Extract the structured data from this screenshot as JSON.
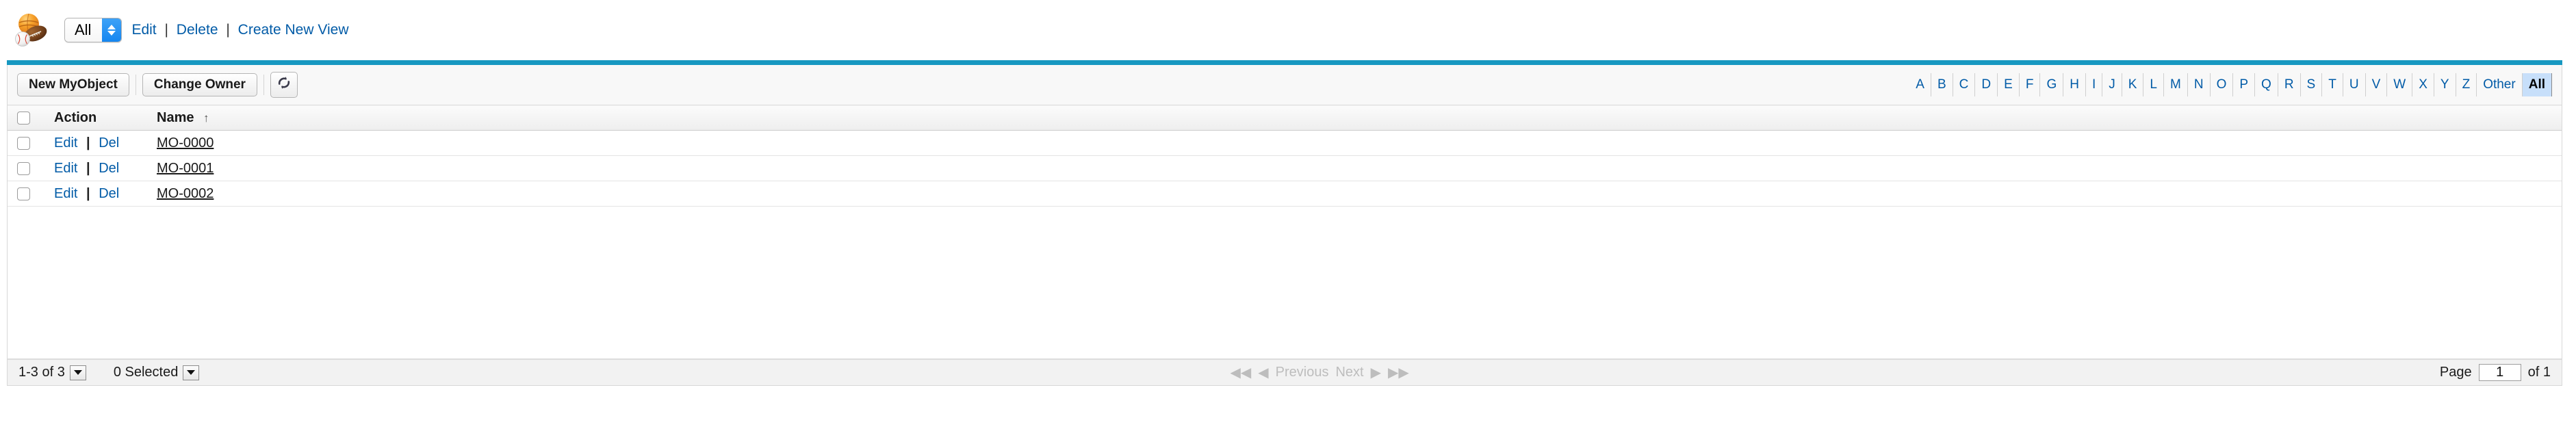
{
  "header": {
    "object_icon": "sports-balls-icon",
    "view_select": {
      "value": "All",
      "stepper_icon": "stepper-updown-icon"
    },
    "links": [
      {
        "label": "Edit",
        "name": "edit-view-link"
      },
      {
        "label": "Delete",
        "name": "delete-view-link"
      },
      {
        "label": "Create New View",
        "name": "create-new-view-link"
      }
    ],
    "separator": "|"
  },
  "toolbar": {
    "new_button": "New MyObject",
    "change_owner_button": "Change Owner",
    "refresh_icon": "refresh-icon"
  },
  "alpha_filter": {
    "letters": [
      "A",
      "B",
      "C",
      "D",
      "E",
      "F",
      "G",
      "H",
      "I",
      "J",
      "K",
      "L",
      "M",
      "N",
      "O",
      "P",
      "Q",
      "R",
      "S",
      "T",
      "U",
      "V",
      "W",
      "X",
      "Y",
      "Z"
    ],
    "other_label": "Other",
    "all_label": "All",
    "selected": "All"
  },
  "table": {
    "columns": {
      "action": "Action",
      "name": "Name"
    },
    "sort_indicator": "↑",
    "sort_column": "Name",
    "action_edit": "Edit",
    "action_del": "Del",
    "action_separator": "|",
    "rows": [
      {
        "name": "MO-0000"
      },
      {
        "name": "MO-0001"
      },
      {
        "name": "MO-0002"
      }
    ]
  },
  "footer": {
    "record_range": "1-3 of 3",
    "selected_count": "0 Selected",
    "first_icon": "◀◀",
    "previous_label": "Previous",
    "previous_icon": "◀",
    "next_label": "Next",
    "next_icon": "▶",
    "last_icon": "▶▶",
    "page_label": "Page",
    "page_value": "1",
    "page_total": "of 1"
  },
  "colors": {
    "accent_teal": "#1798c1",
    "link_blue": "#015ba7",
    "selected_bg": "#c7dffa"
  }
}
